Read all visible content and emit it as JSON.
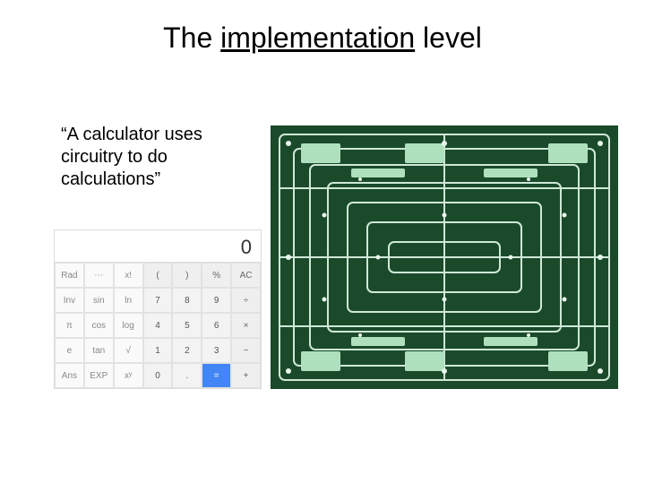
{
  "title": {
    "pre": "The ",
    "underlined": "implementation",
    "post": " level"
  },
  "quote": "“A calculator uses circuitry to do calculations”",
  "calculator": {
    "display": "0",
    "rows": [
      [
        {
          "label": "Rad",
          "cls": "light"
        },
        {
          "label": "⋯",
          "cls": "light"
        },
        {
          "label": "x!",
          "cls": "light"
        },
        {
          "label": "(",
          "cls": "op"
        },
        {
          "label": ")",
          "cls": "op"
        },
        {
          "label": "%",
          "cls": "op"
        },
        {
          "label": "AC",
          "cls": "op"
        }
      ],
      [
        {
          "label": "Inv",
          "cls": "light"
        },
        {
          "label": "sin",
          "cls": "light"
        },
        {
          "label": "ln",
          "cls": "light"
        },
        {
          "label": "7",
          "cls": ""
        },
        {
          "label": "8",
          "cls": ""
        },
        {
          "label": "9",
          "cls": ""
        },
        {
          "label": "÷",
          "cls": "op"
        }
      ],
      [
        {
          "label": "π",
          "cls": "light"
        },
        {
          "label": "cos",
          "cls": "light"
        },
        {
          "label": "log",
          "cls": "light"
        },
        {
          "label": "4",
          "cls": ""
        },
        {
          "label": "5",
          "cls": ""
        },
        {
          "label": "6",
          "cls": ""
        },
        {
          "label": "×",
          "cls": "op"
        }
      ],
      [
        {
          "label": "e",
          "cls": "light"
        },
        {
          "label": "tan",
          "cls": "light"
        },
        {
          "label": "√",
          "cls": "light"
        },
        {
          "label": "1",
          "cls": ""
        },
        {
          "label": "2",
          "cls": ""
        },
        {
          "label": "3",
          "cls": ""
        },
        {
          "label": "−",
          "cls": "op"
        }
      ],
      [
        {
          "label": "Ans",
          "cls": "light"
        },
        {
          "label": "EXP",
          "cls": "light"
        },
        {
          "label": "xʸ",
          "cls": "light"
        },
        {
          "label": "0",
          "cls": ""
        },
        {
          "label": ".",
          "cls": ""
        },
        {
          "label": "=",
          "cls": "eq"
        },
        {
          "label": "+",
          "cls": "op"
        }
      ]
    ]
  },
  "pcb_alt": "circuit-board-image"
}
